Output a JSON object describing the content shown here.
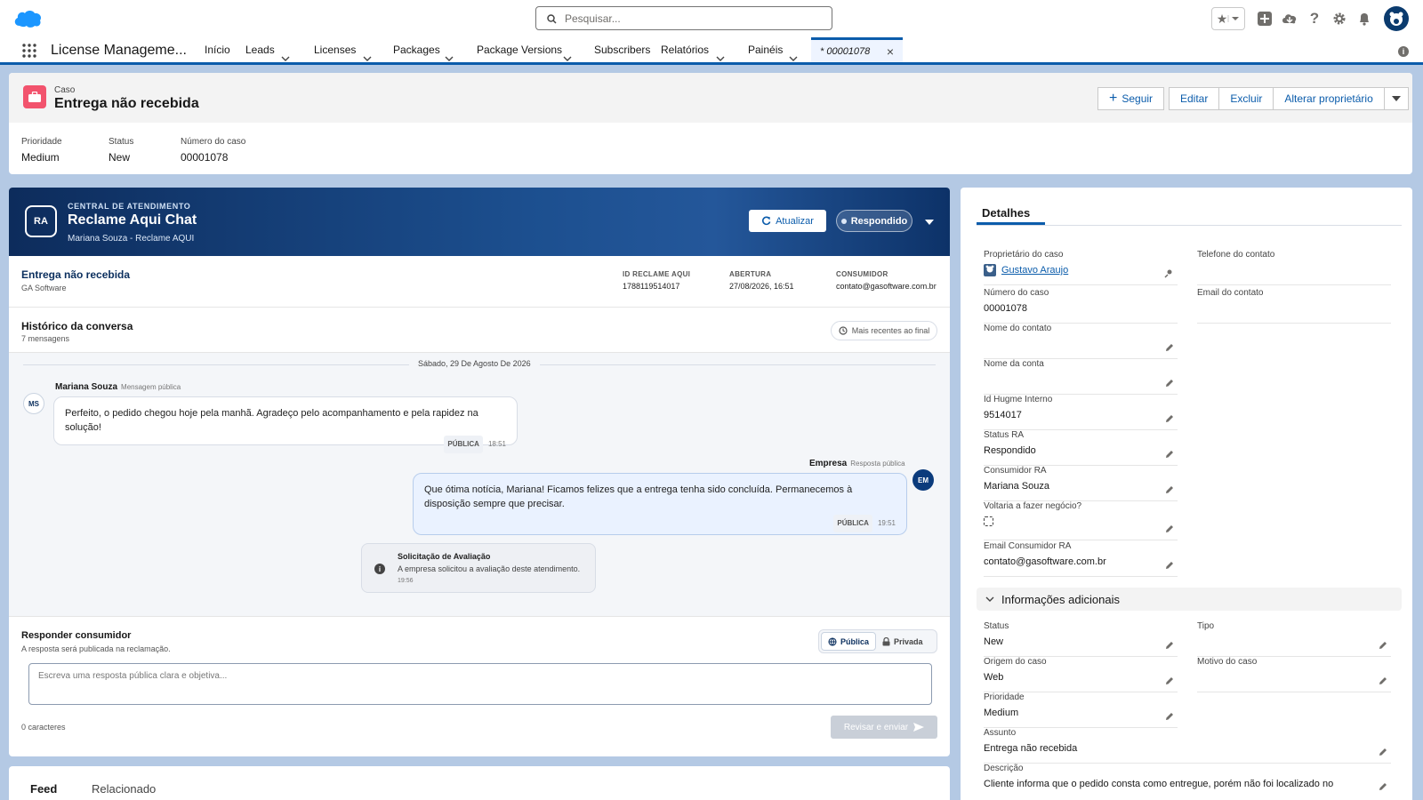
{
  "search": {
    "placeholder": "Pesquisar..."
  },
  "app": {
    "name": "License Manageme..."
  },
  "nav": {
    "items": [
      {
        "label": "Início"
      },
      {
        "label": "Leads"
      },
      {
        "label": "Licenses"
      },
      {
        "label": "Packages"
      },
      {
        "label": "Package Versions"
      },
      {
        "label": "Subscribers"
      },
      {
        "label": "Relatórios"
      },
      {
        "label": "Painéis"
      }
    ],
    "active_tab": "* 00001078",
    "close": "×"
  },
  "record": {
    "type": "Caso",
    "title": "Entrega não recebida",
    "actions": {
      "follow": "Seguir",
      "edit": "Editar",
      "delete": "Excluir",
      "owner": "Alterar proprietário"
    },
    "highlights": [
      {
        "label": "Prioridade",
        "value": "Medium"
      },
      {
        "label": "Status",
        "value": "New"
      },
      {
        "label": "Número do caso",
        "value": "00001078"
      }
    ]
  },
  "ra": {
    "badge": "RA",
    "kicker": "CENTRAL DE ATENDIMENTO",
    "title": "Reclame Aqui Chat",
    "subtitle": "Mariana Souza - Reclame AQUI",
    "refresh": "Atualizar",
    "status": "Respondido",
    "summary": {
      "title": "Entrega não recebida",
      "company": "GA Software",
      "id_label": "ID RECLAME AQUI",
      "id_value": "1788119514017",
      "open_label": "ABERTURA",
      "open_value": "27/08/2026, 16:51",
      "consumer_label": "CONSUMIDOR",
      "consumer_value": "contato@gasoftware.com.br"
    },
    "history": {
      "title": "Histórico da conversa",
      "count": "7 mensagens",
      "order": "Mais recentes ao final"
    },
    "date_sep": "Sábado, 29 De Agosto De 2026",
    "messages": [
      {
        "initials": "MS",
        "author": "Mariana Souza",
        "kind": "Mensagem pública",
        "text": "Perfeito, o pedido chegou hoje pela manhã. Agradeço pelo acompanhamento e pela rapidez na solução!",
        "tag": "PÚBLICA",
        "time": "18:51"
      },
      {
        "initials": "EM",
        "author": "Empresa",
        "kind": "Resposta pública",
        "text": "Que ótima notícia, Mariana! Ficamos felizes que a entrega tenha sido concluída. Permanecemos à disposição sempre que precisar.",
        "tag": "PÚBLICA",
        "time": "19:51"
      }
    ],
    "system": {
      "icon": "i",
      "title": "Solicitação de Avaliação",
      "text": "A empresa solicitou a avaliação deste atendimento.",
      "time": "19:56"
    },
    "reply": {
      "title": "Responder consumidor",
      "subtitle": "A resposta será publicada na reclamação.",
      "public": "Pública",
      "private": "Privada",
      "placeholder": "Escreva uma resposta pública clara e objetiva...",
      "chars": "0 caracteres",
      "send": "Revisar e enviar"
    }
  },
  "feed": {
    "tabs": [
      "Feed",
      "Relacionado"
    ]
  },
  "details": {
    "tab": "Detalhes",
    "fields_left": [
      {
        "label": "Proprietário do caso",
        "value": "Gustavo Araujo"
      },
      {
        "label": "Número do caso",
        "value": "00001078"
      },
      {
        "label": "Nome do contato",
        "value": ""
      },
      {
        "label": "Nome da conta",
        "value": ""
      },
      {
        "label": "Id Hugme Interno",
        "value": "9514017"
      },
      {
        "label": "Status RA",
        "value": "Respondido"
      },
      {
        "label": "Consumidor RA",
        "value": "Mariana Souza"
      },
      {
        "label": "Voltaria a fazer negócio?",
        "value": ""
      },
      {
        "label": "Email Consumidor RA",
        "value": "contato@gasoftware.com.br"
      }
    ],
    "fields_right": [
      {
        "label": "Telefone do contato",
        "value": ""
      },
      {
        "label": "Email do contato",
        "value": ""
      }
    ],
    "section": "Informações adicionais",
    "extra_left": [
      {
        "label": "Status",
        "value": "New"
      },
      {
        "label": "Origem do caso",
        "value": "Web"
      },
      {
        "label": "Prioridade",
        "value": "Medium"
      }
    ],
    "extra_right": [
      {
        "label": "Tipo",
        "value": ""
      },
      {
        "label": "Motivo do caso",
        "value": ""
      }
    ],
    "subject": {
      "label": "Assunto",
      "value": "Entrega não recebida"
    },
    "description": {
      "label": "Descrição",
      "value": "Cliente informa que o pedido consta como entregue, porém não foi localizado no"
    }
  },
  "colors": {
    "brand": "#0b5cab",
    "case_icon": "#f2536d",
    "hero": "#1c4f8f"
  }
}
